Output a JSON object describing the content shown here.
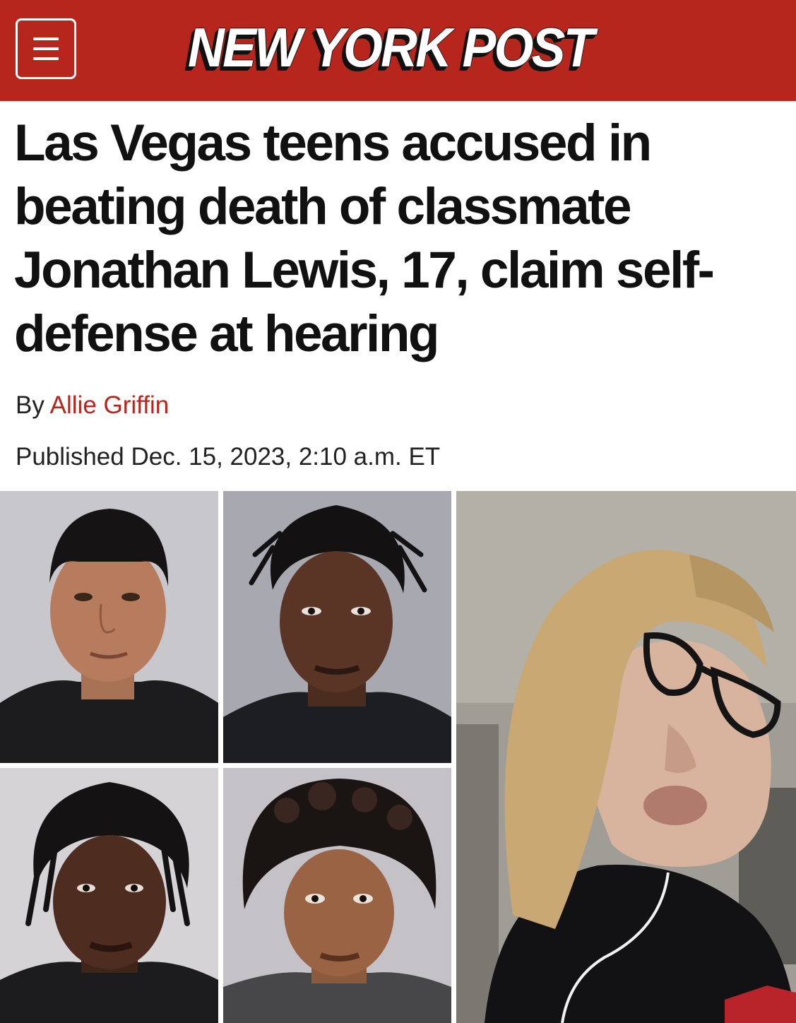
{
  "masthead": {
    "logo_text": "NEW YORK POST",
    "brand_color": "#b7261c",
    "menu_icon": "hamburger-menu-icon"
  },
  "article": {
    "headline": "Las Vegas teens accused in beating death of classmate Jonathan Lewis, 17, claim self-defense at hearing",
    "byline_prefix": "By",
    "author": "Allie Griffin",
    "published": "Published Dec. 15, 2023, 2:10 a.m. ET"
  },
  "accent_colors": {
    "author_link": "#b7261c",
    "text": "#111111"
  }
}
